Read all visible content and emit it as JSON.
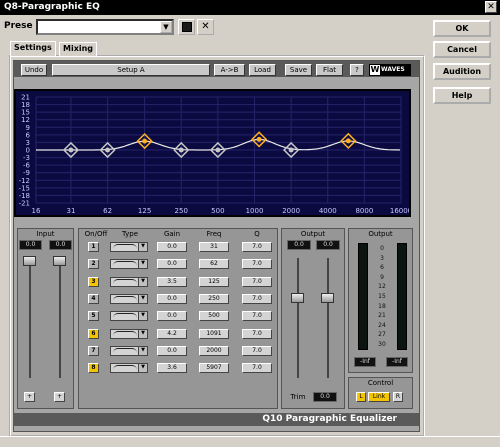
{
  "window": {
    "title": "Q8-Paragraphic EQ",
    "close_glyph": "✕"
  },
  "preset": {
    "label": "Prese",
    "value": ""
  },
  "side_buttons": {
    "ok": "OK",
    "cancel": "Cancel",
    "audition": "Audition",
    "help": "Help"
  },
  "tabs": {
    "settings": "Settings",
    "mixing": "Mixing"
  },
  "toolbar": {
    "undo": "Undo",
    "setup": "Setup A",
    "ab": "A->B",
    "load": "Load",
    "save": "Save",
    "flat": "Flat",
    "help": "?",
    "brand": "WAVES"
  },
  "graph": {
    "db_ticks": [
      "21",
      "18",
      "15",
      "12",
      "9",
      "6",
      "3",
      "0",
      "-3",
      "-6",
      "-9",
      "-12",
      "-15",
      "-18",
      "-21"
    ],
    "freq_ticks": [
      "16",
      "31",
      "62",
      "125",
      "250",
      "500",
      "1000",
      "2000",
      "4000",
      "8000",
      "16000"
    ],
    "curve_color": "#e8e8e8",
    "point_color_inactive": "#c8c8c8",
    "point_color_active": "#ffb020"
  },
  "input": {
    "label": "Input",
    "left": "0.0",
    "right": "0.0"
  },
  "bands_header": {
    "onoff": "On/Off",
    "type": "Type",
    "gain": "Gain",
    "freq": "Freq",
    "q": "Q"
  },
  "bands": [
    {
      "num": "1",
      "on": false,
      "gain": "0.0",
      "freq": "31",
      "q": "7.0"
    },
    {
      "num": "2",
      "on": false,
      "gain": "0.0",
      "freq": "62",
      "q": "7.0"
    },
    {
      "num": "3",
      "on": true,
      "gain": "3.5",
      "freq": "125",
      "q": "7.0"
    },
    {
      "num": "4",
      "on": false,
      "gain": "0.0",
      "freq": "250",
      "q": "7.0"
    },
    {
      "num": "5",
      "on": false,
      "gain": "0.0",
      "freq": "500",
      "q": "7.0"
    },
    {
      "num": "6",
      "on": true,
      "gain": "4.2",
      "freq": "1091",
      "q": "7.0"
    },
    {
      "num": "7",
      "on": false,
      "gain": "0.0",
      "freq": "2000",
      "q": "7.0"
    },
    {
      "num": "8",
      "on": true,
      "gain": "3.6",
      "freq": "5907",
      "q": "7.0"
    }
  ],
  "output": {
    "label": "Output",
    "left": "0.0",
    "right": "0.0",
    "trim_label": "Trim",
    "trim_value": "0.0"
  },
  "meter": {
    "label": "Output",
    "scale": [
      "0",
      "3",
      "6",
      "9",
      "12",
      "15",
      "18",
      "21",
      "24",
      "27",
      "30"
    ],
    "peak_left": "-Inf",
    "peak_right": "-Inf"
  },
  "control": {
    "label": "Control",
    "l": "L",
    "link": "Link",
    "r": "R"
  },
  "footer": {
    "product": "Q10 Paragraphic Equalizer"
  },
  "colors": {
    "band_on": "#f5c400",
    "band_off": "#b4b4b4"
  }
}
